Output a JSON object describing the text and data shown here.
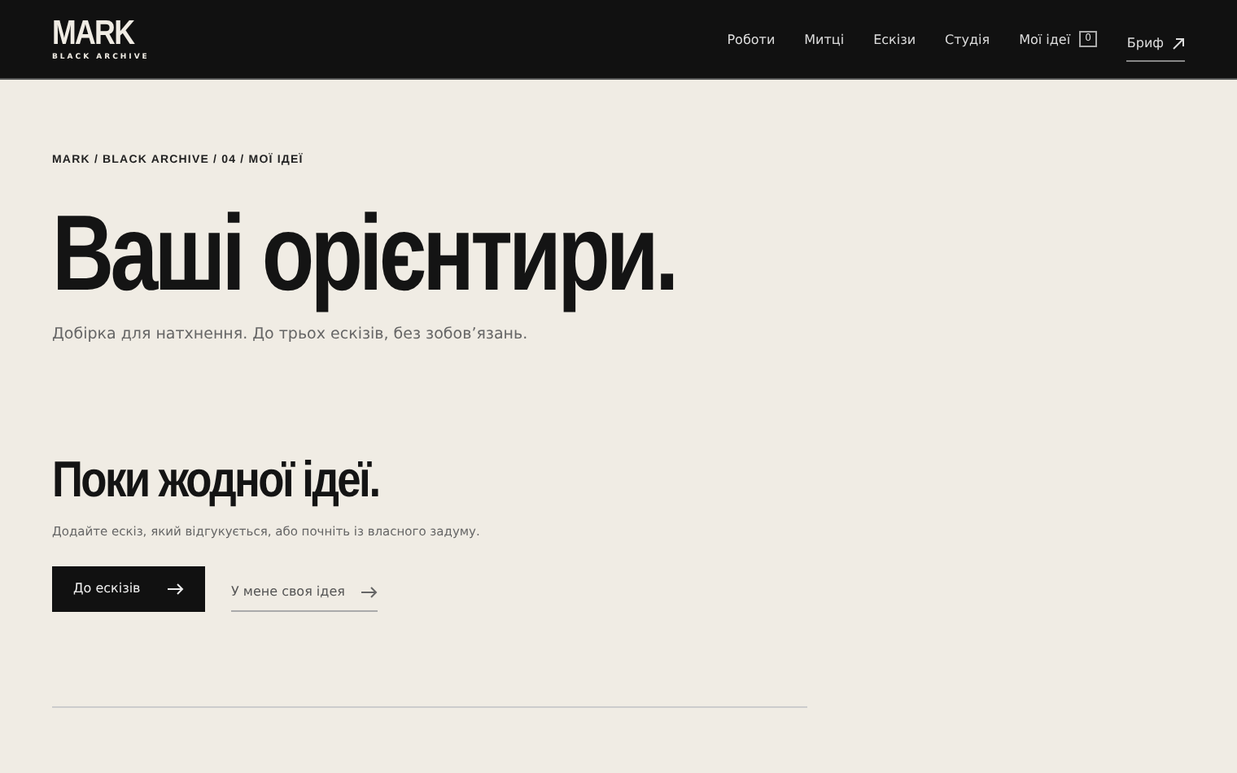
{
  "header": {
    "logo": "MARK",
    "logo_sub": "BLACK ARCHIVE",
    "nav": [
      {
        "label": "Роботи",
        "kind": "link"
      },
      {
        "label": "Митці",
        "kind": "link"
      },
      {
        "label": "Ескізи",
        "kind": "link"
      },
      {
        "label": "Студія",
        "kind": "link"
      },
      {
        "label": "Мої ідеї",
        "kind": "count",
        "count": "0"
      },
      {
        "label": "Бриф",
        "kind": "external"
      }
    ]
  },
  "breadcrumb": "MARK / BLACK ARCHIVE / 04 / МОЇ ІДЕЇ",
  "title": "Ваші орієнтири.",
  "subtitle": "Добірка для натхнення. До трьох ескізів, без зобов’язань.",
  "empty": {
    "heading": "Поки жодної ідеї.",
    "text": "Додайте ескіз, який відгукується, або почніть із власного задуму.",
    "actions": [
      {
        "label": "До ескізів",
        "kind": "primary"
      },
      {
        "label": "У мене своя ідея",
        "kind": "secondary"
      }
    ]
  }
}
